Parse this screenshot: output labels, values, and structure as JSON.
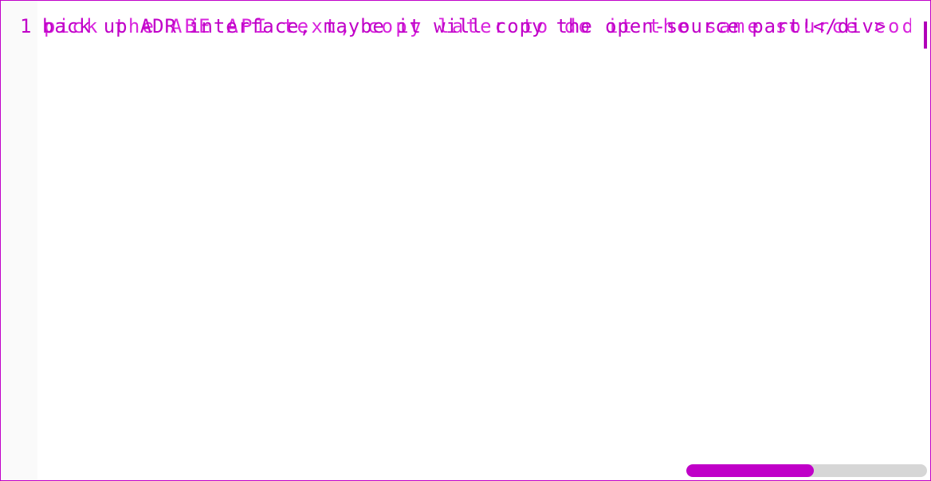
{
  "editor": {
    "line_number": "1",
    "line_text_primary": "back up ADR interface, maybe it will copy the open-source part!</div>",
    "line_text_secondary": "pick the ABE API text, copy later to do it the same source code."
  },
  "horizontal_scroll": {
    "position_fraction": 0.53
  },
  "colors": {
    "accent": "#c000c8",
    "track": "#d6d6d6",
    "gutter": "#fafafa"
  },
  "icons": {
    "cursor": "text-cursor-icon"
  }
}
